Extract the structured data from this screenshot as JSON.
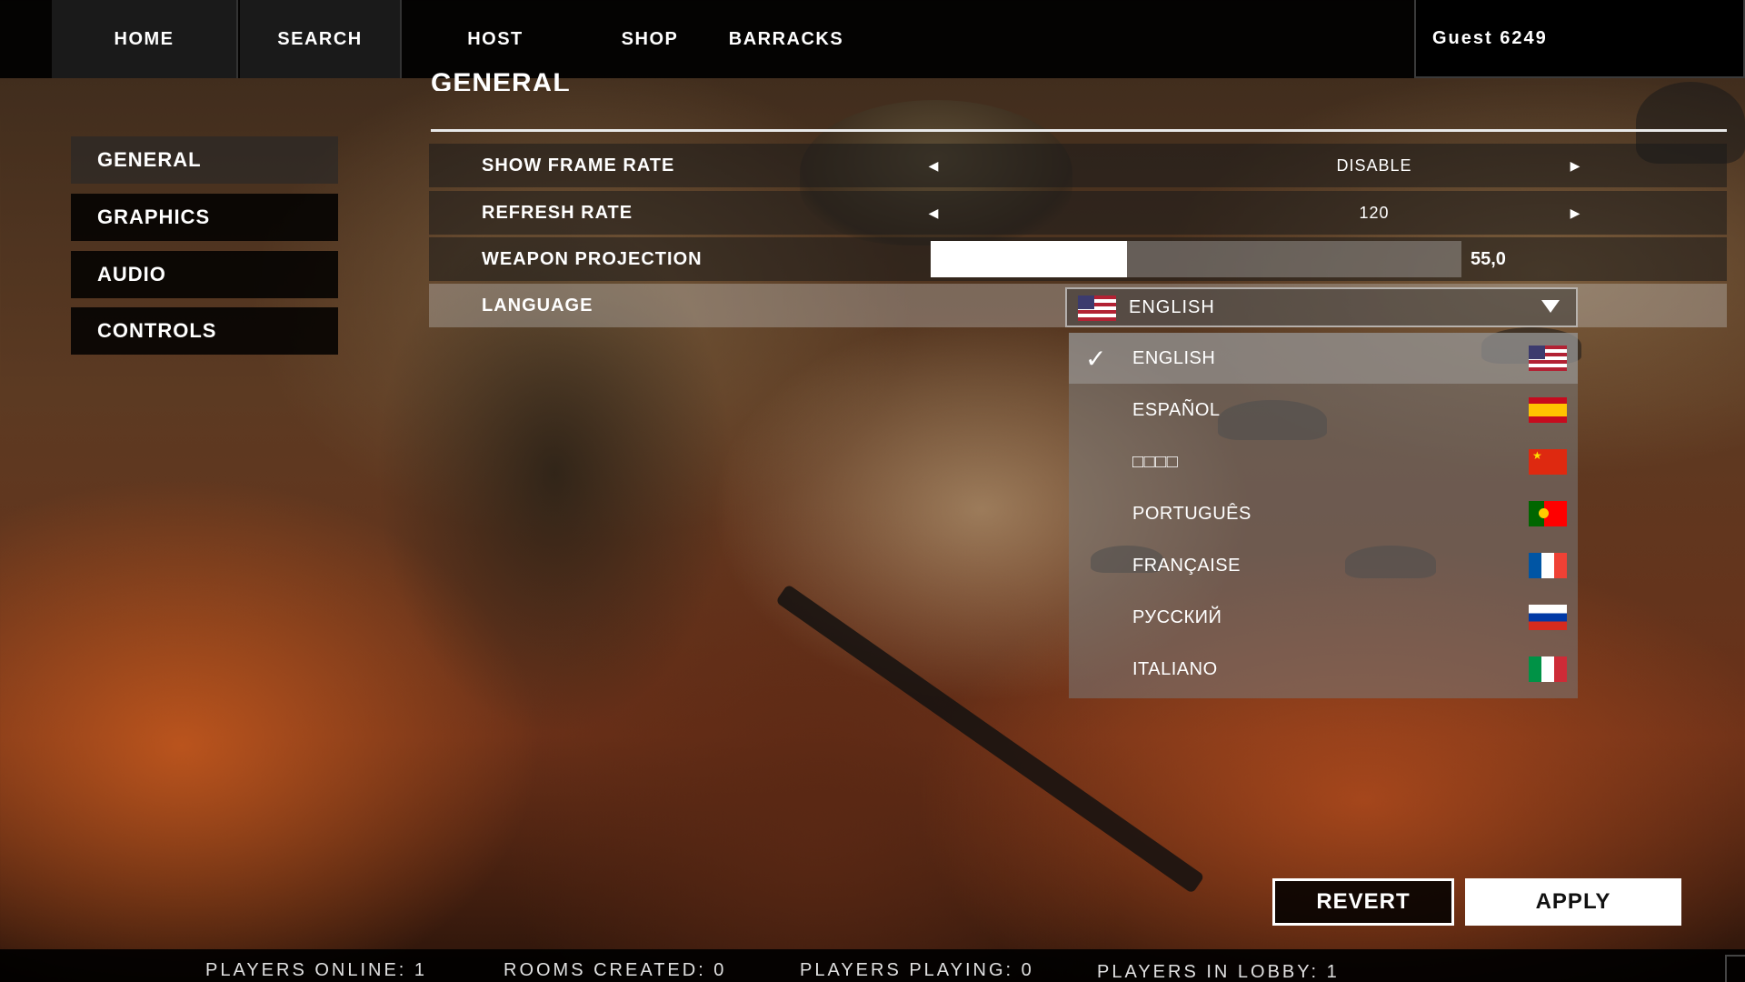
{
  "nav": {
    "items": [
      {
        "label": "HOME"
      },
      {
        "label": "SEARCH"
      },
      {
        "label": "HOST"
      },
      {
        "label": "SHOP"
      },
      {
        "label": "BARRACKS"
      }
    ],
    "user_label": "Guest 6249"
  },
  "section": {
    "title": "GENERAL"
  },
  "sidebar": {
    "items": [
      {
        "label": "GENERAL"
      },
      {
        "label": "GRAPHICS"
      },
      {
        "label": "AUDIO"
      },
      {
        "label": "CONTROLS"
      }
    ],
    "active": "GENERAL"
  },
  "settings": {
    "frame_rate": {
      "label": "SHOW FRAME RATE",
      "value": "DISABLE"
    },
    "refresh_rate": {
      "label": "REFRESH RATE",
      "value": "120"
    },
    "weapon_projection": {
      "label": "WEAPON PROJECTION",
      "value_text": "55,0",
      "fill_fraction": 0.37
    },
    "language": {
      "label": "LANGUAGE",
      "selected": "ENGLISH",
      "options": [
        {
          "label": "ENGLISH",
          "flag": "flag-us",
          "selected": true
        },
        {
          "label": "ESPAÑOL",
          "flag": "flag-es",
          "selected": false
        },
        {
          "label": "□□□□",
          "flag": "flag-cn",
          "selected": false
        },
        {
          "label": "PORTUGUÊS",
          "flag": "flag-pt",
          "selected": false
        },
        {
          "label": "FRANÇAISE",
          "flag": "flag-fr",
          "selected": false
        },
        {
          "label": "РУССКИЙ",
          "flag": "flag-ru",
          "selected": false
        },
        {
          "label": "ITALIANO",
          "flag": "flag-it",
          "selected": false
        }
      ]
    }
  },
  "icons": {
    "arrow_left": "◀",
    "arrow_right": "▶",
    "check": "✓",
    "caret": "caret-down-icon"
  },
  "buttons": {
    "revert": "REVERT",
    "apply": "APPLY"
  },
  "status": {
    "players_online": "PLAYERS ONLINE: 1",
    "rooms_created": "ROOMS CREATED: 0",
    "players_playing": "PLAYERS PLAYING: 0",
    "players_in_lobby": "PLAYERS IN LOBBY: 1"
  }
}
